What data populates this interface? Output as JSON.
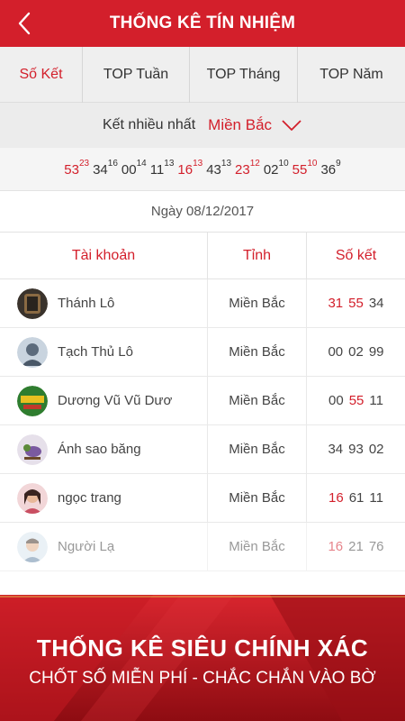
{
  "appbar": {
    "title": "THỐNG KÊ TÍN NHIỆM",
    "back_icon": "chevron-left-icon"
  },
  "tabs": [
    {
      "label": "Số Kết",
      "active": true
    },
    {
      "label": "TOP Tuần",
      "active": false
    },
    {
      "label": "TOP Tháng",
      "active": false
    },
    {
      "label": "TOP Năm",
      "active": false
    }
  ],
  "filter": {
    "label": "Kết nhiều nhất",
    "region": "Miền Bắc",
    "icon": "chevron-down-icon"
  },
  "top_numbers": [
    {
      "number": "53",
      "count": "23",
      "hot": true
    },
    {
      "number": "34",
      "count": "16",
      "hot": false
    },
    {
      "number": "00",
      "count": "14",
      "hot": false
    },
    {
      "number": "11",
      "count": "13",
      "hot": false
    },
    {
      "number": "16",
      "count": "13",
      "hot": true
    },
    {
      "number": "43",
      "count": "13",
      "hot": false
    },
    {
      "number": "23",
      "count": "12",
      "hot": true
    },
    {
      "number": "02",
      "count": "10",
      "hot": false
    },
    {
      "number": "55",
      "count": "10",
      "hot": true
    },
    {
      "number": "36",
      "count": "9",
      "hot": false
    }
  ],
  "date": "Ngày 08/12/2017",
  "table": {
    "headers": [
      "Tài khoản",
      "Tỉnh",
      "Số kết"
    ],
    "rows": [
      {
        "name": "Thánh Lô",
        "province": "Miền Bắc",
        "numbers": [
          {
            "v": "31",
            "hot": true
          },
          {
            "v": "55",
            "hot": true
          },
          {
            "v": "34",
            "hot": false
          }
        ]
      },
      {
        "name": "Tạch Thủ Lô",
        "province": "Miền Bắc",
        "numbers": [
          {
            "v": "00",
            "hot": false
          },
          {
            "v": "02",
            "hot": false
          },
          {
            "v": "99",
            "hot": false
          }
        ]
      },
      {
        "name": "Dương Vũ Vũ Dươ",
        "province": "Miền Bắc",
        "numbers": [
          {
            "v": "00",
            "hot": false
          },
          {
            "v": "55",
            "hot": true
          },
          {
            "v": "11",
            "hot": false
          }
        ]
      },
      {
        "name": "Ánh sao băng",
        "province": "Miền Bắc",
        "numbers": [
          {
            "v": "34",
            "hot": false
          },
          {
            "v": "93",
            "hot": false
          },
          {
            "v": "02",
            "hot": false
          }
        ]
      },
      {
        "name": "ngọc trang",
        "province": "Miền Bắc",
        "numbers": [
          {
            "v": "16",
            "hot": true
          },
          {
            "v": "61",
            "hot": false
          },
          {
            "v": "11",
            "hot": false
          }
        ]
      },
      {
        "name": "Người Lạ",
        "province": "Miền Bắc",
        "numbers": [
          {
            "v": "16",
            "hot": true
          },
          {
            "v": "21",
            "hot": false
          },
          {
            "v": "76",
            "hot": false
          }
        ]
      }
    ]
  },
  "promo": {
    "headline": "THỐNG KÊ SIÊU CHÍNH XÁC",
    "subline": "CHỐT SỐ MIỄN PHÍ - CHẮC CHẮN VÀO BỜ"
  },
  "colors": {
    "primary": "#d31f2b",
    "promo_bg": "#b01219"
  }
}
